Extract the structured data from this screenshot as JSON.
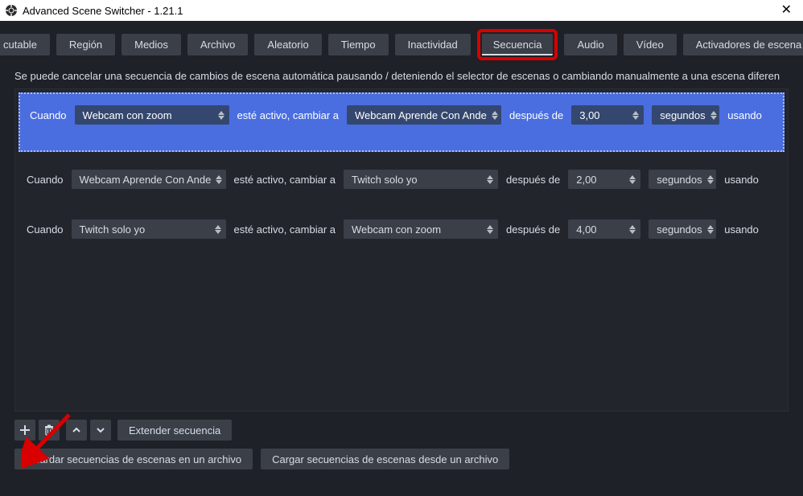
{
  "window": {
    "title": "Advanced Scene Switcher - 1.21.1"
  },
  "tabs": {
    "items": [
      "cutable",
      "Región",
      "Medios",
      "Archivo",
      "Aleatorio",
      "Tiempo",
      "Inactividad",
      "Secuencia",
      "Audio",
      "Vídeo",
      "Activadores de escena"
    ],
    "active_index": 7
  },
  "description": "Se puede cancelar una secuencia de cambios de escena automática pausando / deteniendo el selector de escenas o cambiando manualmente a una escena diferen",
  "labels": {
    "when": "Cuando",
    "active_switch_to": "esté activo, cambiar a",
    "after": "después de",
    "using": "usando"
  },
  "sequence": {
    "rows": [
      {
        "selected": true,
        "scene_from": "Webcam con zoom",
        "scene_to": "Webcam Aprende Con Ande",
        "delay": "3,00",
        "unit": "segundos"
      },
      {
        "selected": false,
        "scene_from": "Webcam Aprende Con Ande",
        "scene_to": "Twitch solo yo",
        "delay": "2,00",
        "unit": "segundos"
      },
      {
        "selected": false,
        "scene_from": "Twitch solo yo",
        "scene_to": "Webcam con zoom",
        "delay": "4,00",
        "unit": "segundos"
      }
    ]
  },
  "buttons": {
    "extend": "Extender secuencia",
    "save": "Guardar secuencias de escenas en un archivo",
    "load": "Cargar secuencias de escenas desde un archivo"
  }
}
